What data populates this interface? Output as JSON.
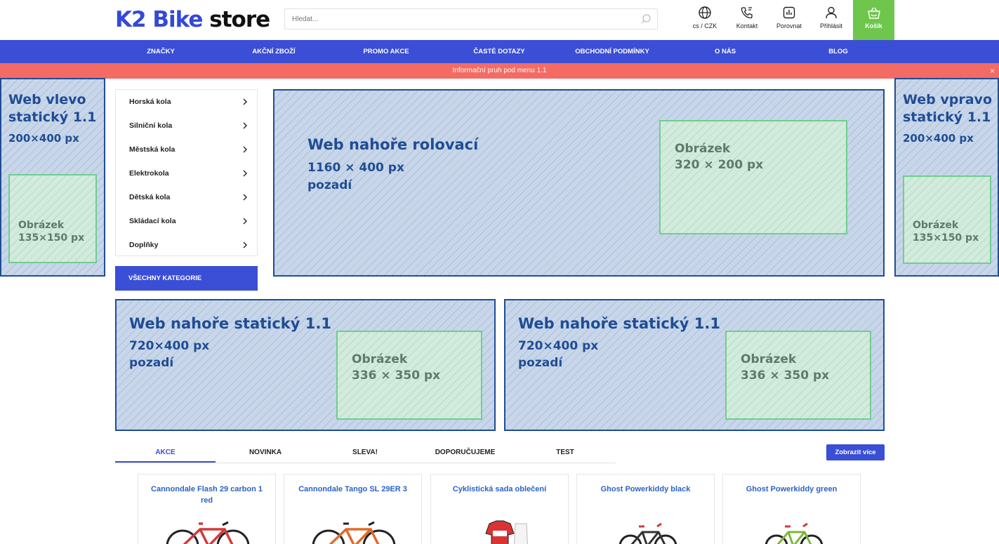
{
  "header": {
    "logo_k2": "K2 Bike",
    "logo_store": "store",
    "search_placeholder": "Hledat...",
    "lang": "cs / CZK",
    "contact": "Kontakt",
    "compare": "Porovnat",
    "login": "Přihlásit",
    "cart": "Košík"
  },
  "nav": {
    "items": [
      "ZNAČKY",
      "AKČNÍ ZBOŽÍ",
      "PROMO AKCE",
      "ČASTÉ DOTAZY",
      "OBCHODNÍ PODMÍNKY",
      "O NÁS",
      "BLOG"
    ]
  },
  "infobar": {
    "text": "Informační pruh pod menu 1.1",
    "close": "×"
  },
  "left_banner": {
    "title": "Web vlevo\nstatický 1.1",
    "size": "200×400 px",
    "img_label": "Obrázek\n135×150 px"
  },
  "right_banner": {
    "title": "Web vpravo\nstatický 1.1",
    "size": "200×400 px",
    "img_label": "Obrázek\n135×150 px"
  },
  "top_banner": {
    "title": "Web nahoře rolovací",
    "size": "1160 × 400 px",
    "bg": "pozadí",
    "img_label": "Obrázek\n320 × 200 px"
  },
  "static_banners": [
    {
      "title": "Web nahoře statický 1.1",
      "size": "720×400 px",
      "bg": "pozadí",
      "img_label": "Obrázek\n336 × 350 px"
    },
    {
      "title": "Web nahoře statický 1.1",
      "size": "720×400 px",
      "bg": "pozadí",
      "img_label": "Obrázek\n336 × 350 px"
    }
  ],
  "categories": {
    "items": [
      "Horská kola",
      "Silniční kola",
      "Městská kola",
      "Elektrokola",
      "Dětská kola",
      "Skládací kola",
      "Doplňky"
    ],
    "all_label": "VŠECHNY KATEGORIE"
  },
  "tabs": {
    "items": [
      "AKCE",
      "NOVINKA",
      "SLEVA!",
      "DOPORUČUJEME",
      "TEST"
    ],
    "active": "AKCE",
    "more_label": "Zobrazit více"
  },
  "products": [
    {
      "title": "Cannondale Flash 29 carbon 1 red"
    },
    {
      "title": "Cannondale Tango SL 29ER 3"
    },
    {
      "title": "Cyklistická sada oblečení"
    },
    {
      "title": "Ghost Powerkiddy black"
    },
    {
      "title": "Ghost Powerkiddy green"
    }
  ],
  "colors": {
    "brand_blue": "#3a4ed6",
    "cart_green": "#6fc64c",
    "infobar_red": "#f46b64",
    "banner_blue": "#c8d6ea",
    "banner_border": "#1f4d94",
    "image_green": "#d2ebdc"
  },
  "icons": [
    "search-icon",
    "globe-icon",
    "phone-icon",
    "compare-icon",
    "user-icon",
    "basket-icon",
    "chevron-right-icon",
    "close-icon"
  ]
}
